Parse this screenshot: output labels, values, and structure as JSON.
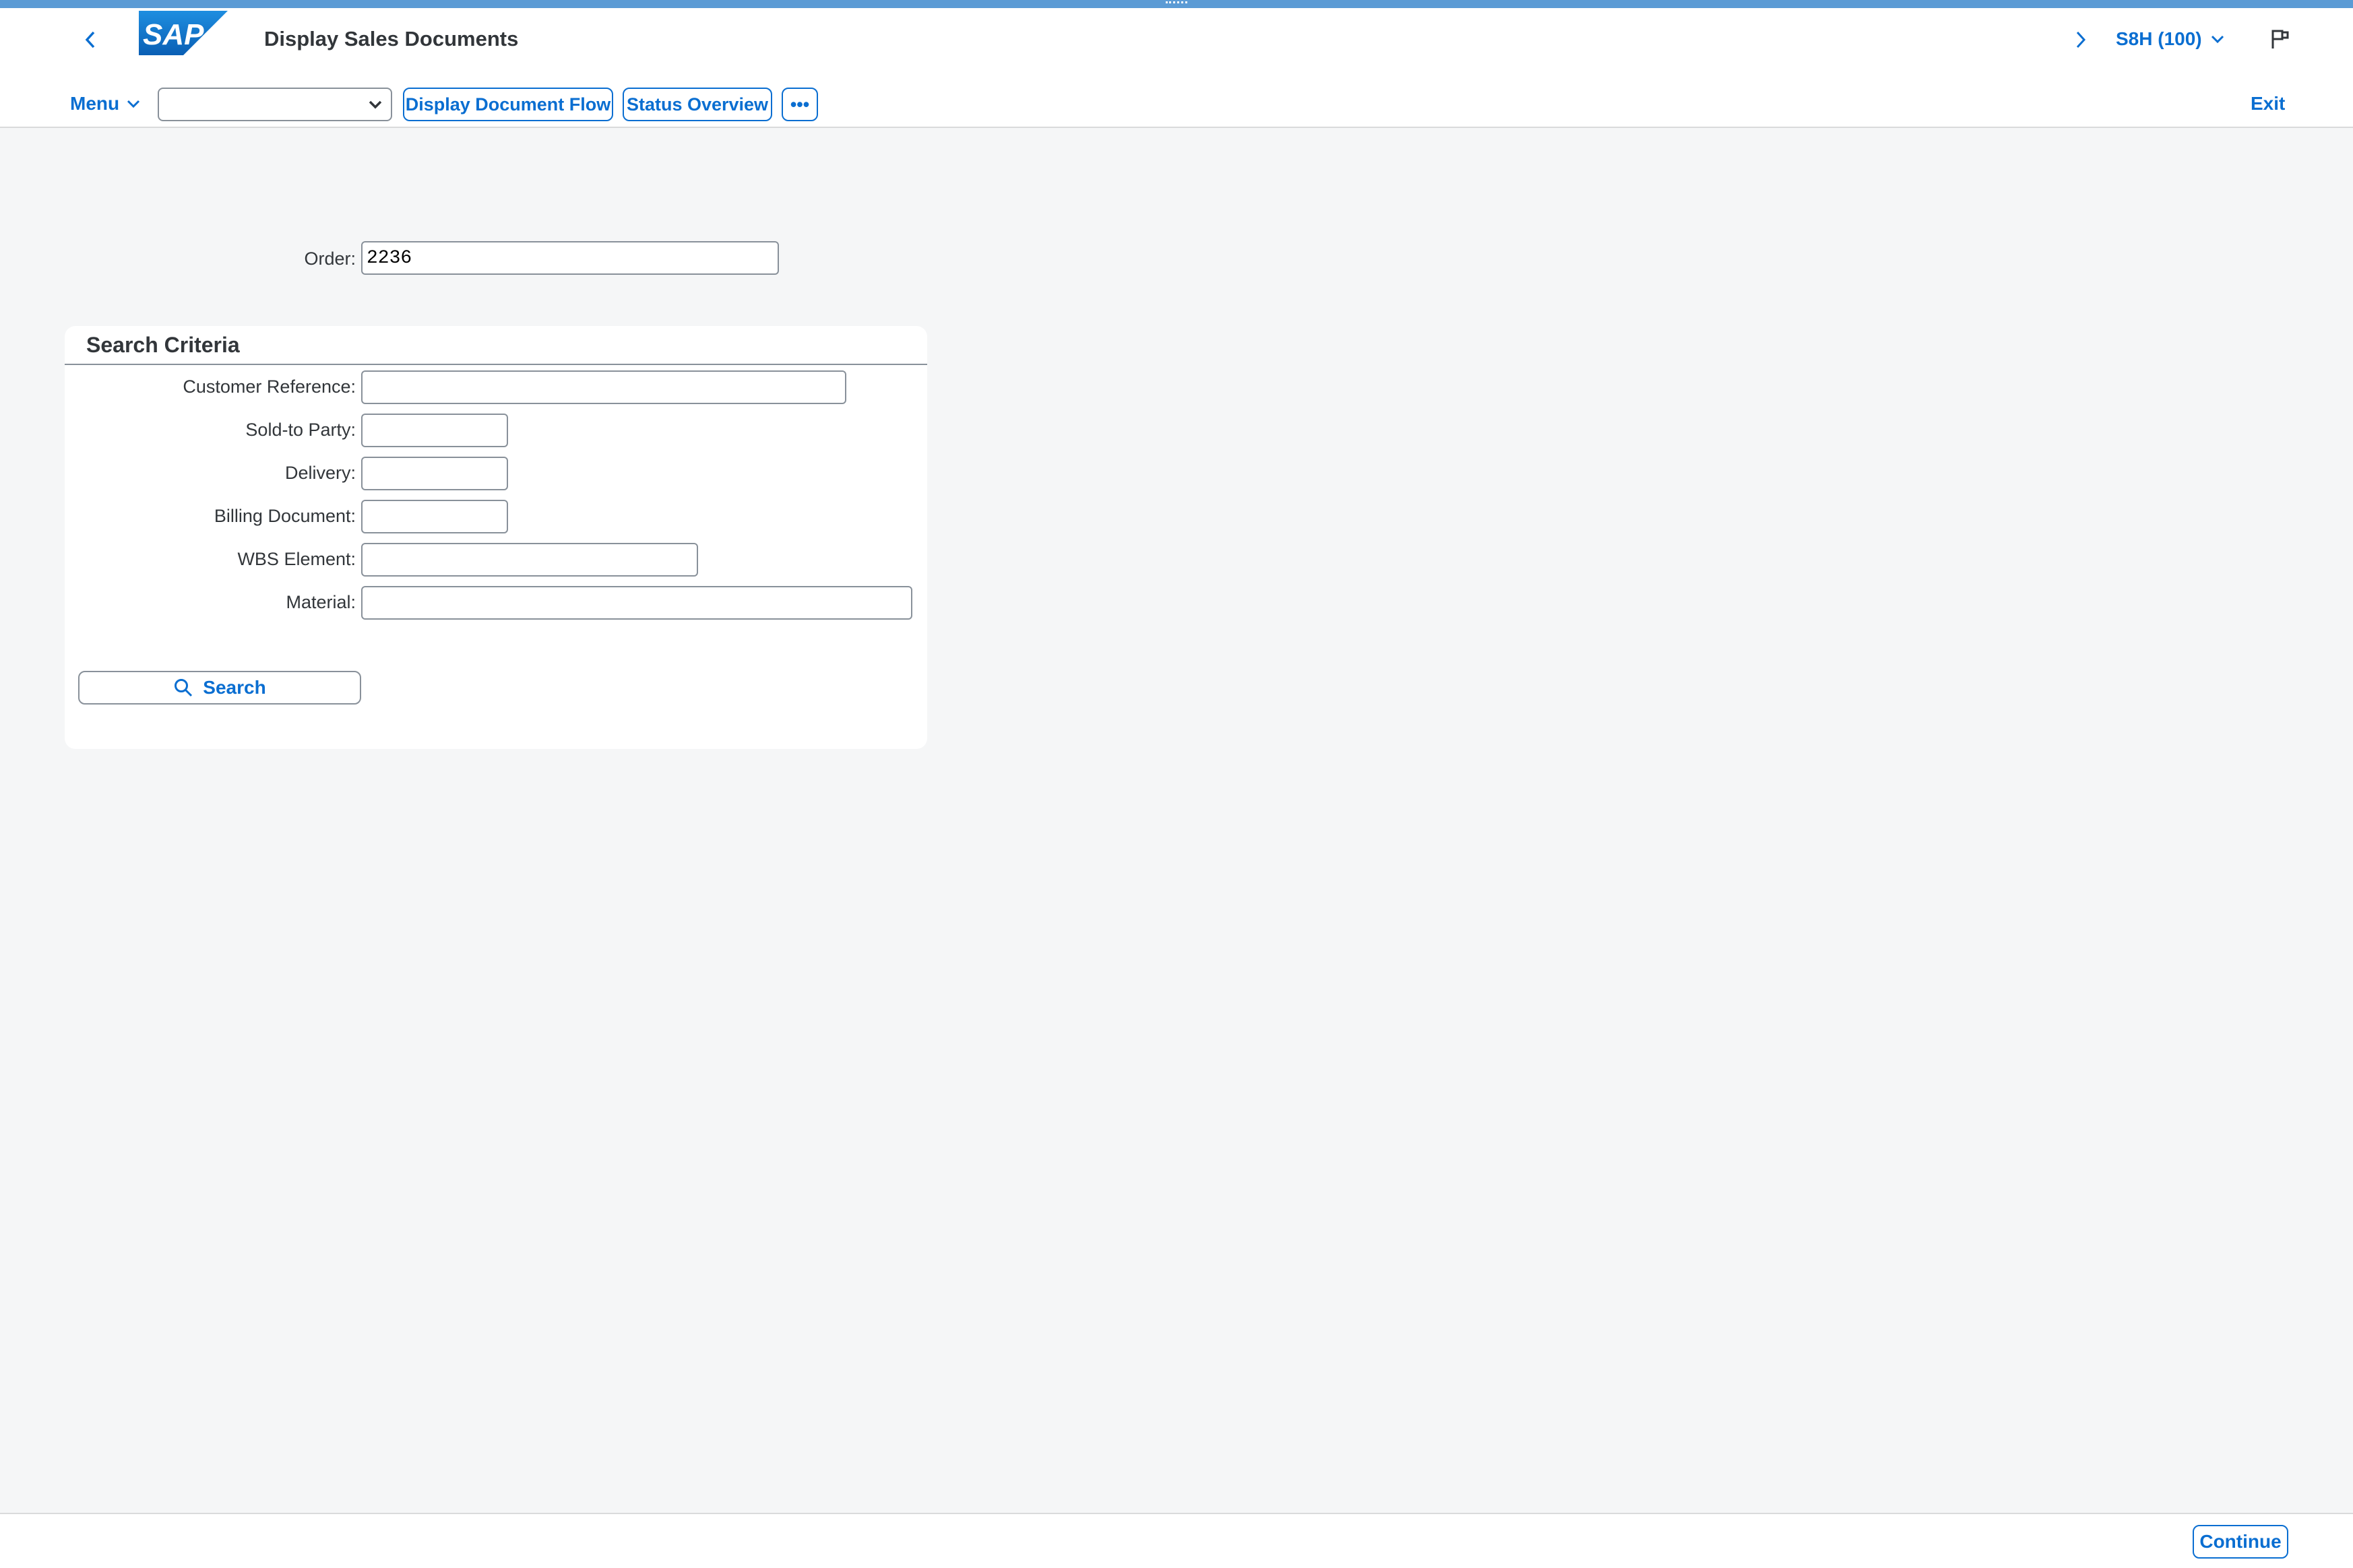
{
  "shell": {
    "title": "Display Sales Documents",
    "system": "S8H (100)",
    "logo_text": "SAP"
  },
  "toolbar": {
    "menu_label": "Menu",
    "combo_value": "",
    "display_document_flow": "Display Document Flow",
    "status_overview": "Status Overview",
    "more_label": "•••",
    "exit_label": "Exit"
  },
  "order": {
    "label": "Order:",
    "value": "2236"
  },
  "search_criteria": {
    "title": "Search Criteria",
    "fields": [
      {
        "label": "Customer Reference:",
        "value": ""
      },
      {
        "label": "Sold-to Party:",
        "value": ""
      },
      {
        "label": "Delivery:",
        "value": ""
      },
      {
        "label": "Billing Document:",
        "value": ""
      },
      {
        "label": "WBS Element:",
        "value": ""
      },
      {
        "label": "Material:",
        "value": ""
      }
    ],
    "search_label": "Search"
  },
  "footer": {
    "continue_label": "Continue"
  },
  "colors": {
    "accent": "#0a6ed1",
    "top_strip": "#5b9bd5",
    "background": "#f5f6f7"
  }
}
